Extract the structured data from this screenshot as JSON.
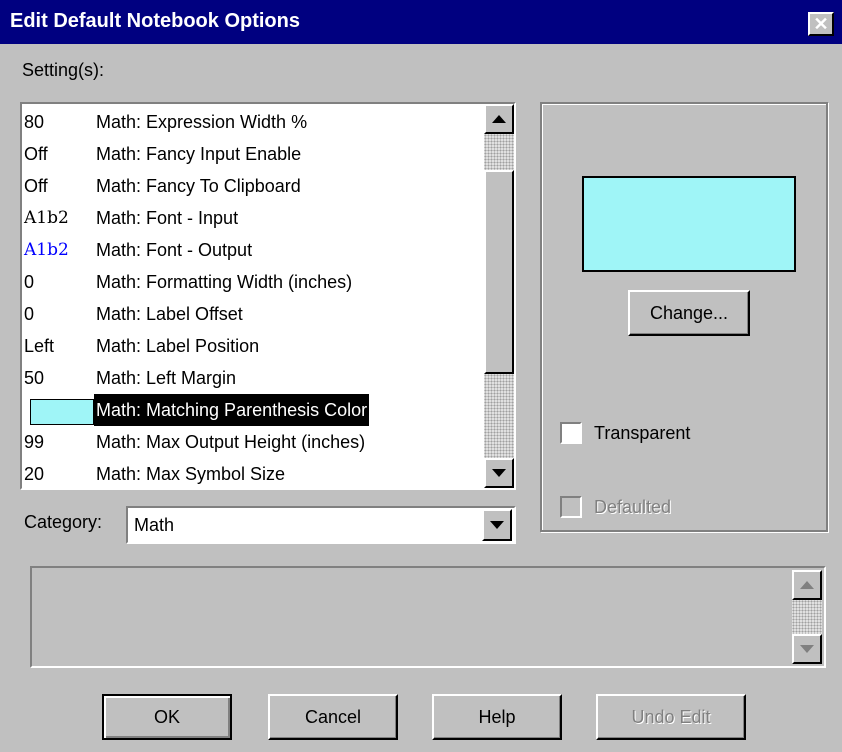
{
  "window": {
    "title": "Edit Default Notebook Options",
    "close_glyph": "✕"
  },
  "settings": {
    "label": "Setting(s):",
    "rows": [
      {
        "value": "80",
        "name": "Math: Expression Width %"
      },
      {
        "value": "Off",
        "name": "Math: Fancy Input Enable"
      },
      {
        "value": "Off",
        "name": "Math: Fancy To Clipboard"
      },
      {
        "value": "A1b2",
        "name": "Math: Font - Input",
        "value_color": "#000000"
      },
      {
        "value": "A1b2",
        "name": "Math: Font - Output",
        "value_color": "#0000ff"
      },
      {
        "value": "0",
        "name": "Math: Formatting Width (inches)"
      },
      {
        "value": "0",
        "name": "Math: Label Offset"
      },
      {
        "value": "Left",
        "name": "Math: Label Position"
      },
      {
        "value": "50",
        "name": "Math: Left Margin"
      },
      {
        "value": "",
        "name": "Math: Matching Parenthesis Color",
        "selected": true,
        "swatch_color": "#9ff5f7"
      },
      {
        "value": "99",
        "name": "Math: Max Output Height (inches)"
      },
      {
        "value": "20",
        "name": "Math: Max Symbol Size"
      }
    ]
  },
  "preview": {
    "color": "#9ff5f7",
    "change_label": "Change...",
    "transparent_label": "Transparent",
    "transparent_checked": false,
    "defaulted_label": "Defaulted",
    "defaulted_checked": false
  },
  "category": {
    "label": "Category:",
    "selected": "Math"
  },
  "description": {
    "text": ""
  },
  "buttons": {
    "ok": "OK",
    "cancel": "Cancel",
    "help": "Help",
    "undo": "Undo Edit"
  },
  "colors": {
    "title_bar": "#000080",
    "dialog_bg": "#c0c0c0",
    "selection": "#000000",
    "swatch": "#9ff5f7"
  }
}
